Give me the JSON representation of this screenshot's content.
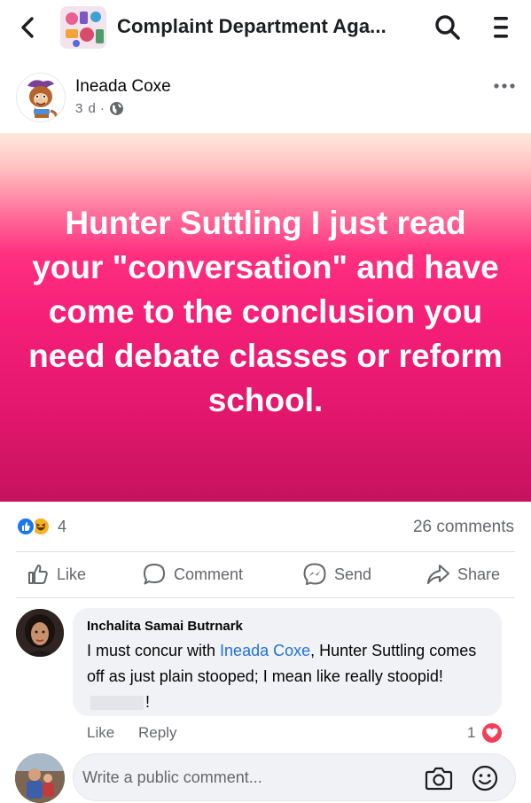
{
  "header": {
    "title": "Complaint Department Aga...",
    "back_icon": "chevron-left-icon",
    "search_icon": "search-icon",
    "menu_icon": "hamburger-menu-icon"
  },
  "post": {
    "author": "Ineada Coxe",
    "time": "3 d",
    "audience_icon": "globe-icon",
    "more_icon": "more-dots-icon",
    "text": "Hunter Suttling I just read your \"conversation\" and have come to the conclusion you need debate classes or reform school."
  },
  "stats": {
    "reaction_count": "4",
    "reactions": [
      "like",
      "haha"
    ],
    "comments": "26 comments"
  },
  "actions": {
    "like": "Like",
    "comment": "Comment",
    "send": "Send",
    "share": "Share"
  },
  "comment": {
    "author": "Inchalita Samai Butrnark",
    "text_before": "I must concur with ",
    "mention": "Ineada Coxe",
    "text_after": ", Hunter Suttling comes off as just plain stooped; I mean like really stoopid!",
    "text_end": "!",
    "like_label": "Like",
    "reply_label": "Reply",
    "reaction_count": "1",
    "reaction": "love"
  },
  "composer": {
    "placeholder": "Write a public comment...",
    "camera_icon": "camera-icon",
    "emoji_icon": "emoji-icon"
  },
  "colors": {
    "accent_blue": "#1877f2",
    "mention_blue": "#216fdb",
    "secondary_text": "#65676b",
    "banner_pink": "#f51f78",
    "love_red": "#f33e58"
  }
}
